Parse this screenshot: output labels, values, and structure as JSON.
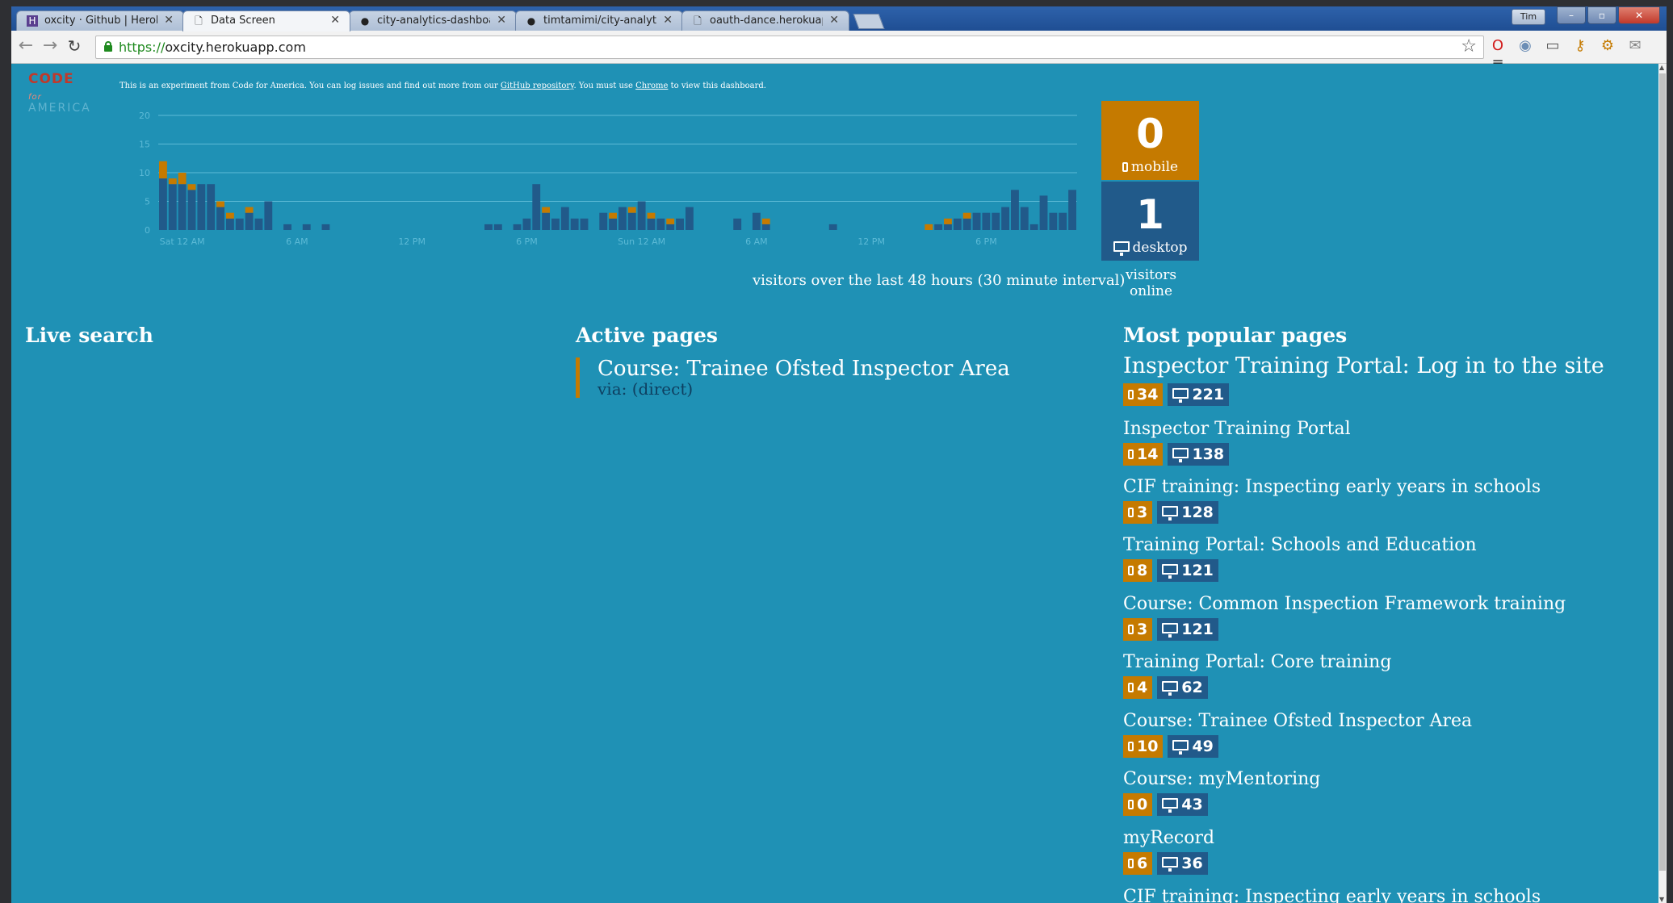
{
  "browser": {
    "tabs": [
      {
        "title": "oxcity · Github | Heroku",
        "icon": "heroku-icon",
        "active": false
      },
      {
        "title": "Data Screen",
        "icon": "page-icon",
        "active": true
      },
      {
        "title": "city-analytics-dashboard/l",
        "icon": "github-icon",
        "active": false
      },
      {
        "title": "timtamimi/city-analytics-d",
        "icon": "github-icon",
        "active": false
      },
      {
        "title": "oauth-dance.herokuapp.c",
        "icon": "page-icon",
        "active": false
      }
    ],
    "user_label": "Tim",
    "url_scheme": "https://",
    "url_host": "oxcity.herokuapp.com"
  },
  "header": {
    "logo_line1": "CODE",
    "logo_line1_small": "for",
    "logo_line2": "AMERICA",
    "intro_before": "This is an experiment from Code for America. You can log issues and find out more from our ",
    "intro_link1": "GitHub repository",
    "intro_middle": ". You must use ",
    "intro_link2": "Chrome",
    "intro_after": " to view this dashboard."
  },
  "chart_data": {
    "type": "bar",
    "stacked": true,
    "title": "",
    "caption": "visitors over the last 48 hours (30 minute interval)",
    "ylim": [
      0,
      20
    ],
    "yticks": [
      0,
      5,
      10,
      15,
      20
    ],
    "xtick_labels": [
      "Sat 12 AM",
      "6 AM",
      "12 PM",
      "6 PM",
      "Sun 12 AM",
      "6 AM",
      "12 PM",
      "6 PM"
    ],
    "xtick_positions": [
      2,
      14,
      26,
      38,
      50,
      62,
      74,
      86
    ],
    "n_bins": 96,
    "grid": true,
    "colors": {
      "desktop": "#215a8a",
      "mobile": "#c57a00"
    },
    "series": [
      {
        "name": "desktop",
        "values": [
          9,
          8,
          8,
          7,
          8,
          8,
          4,
          2,
          2,
          3,
          2,
          5,
          0,
          1,
          0,
          1,
          0,
          1,
          0,
          0,
          0,
          0,
          0,
          0,
          0,
          0,
          0,
          0,
          0,
          0,
          0,
          0,
          0,
          0,
          1,
          1,
          0,
          1,
          2,
          8,
          3,
          2,
          4,
          2,
          2,
          0,
          3,
          2,
          4,
          3,
          5,
          2,
          2,
          1,
          2,
          4,
          0,
          0,
          0,
          0,
          2,
          0,
          3,
          1,
          0,
          0,
          0,
          0,
          0,
          0,
          1,
          0,
          0,
          0,
          0,
          0,
          0,
          0,
          0,
          0,
          0,
          1,
          1,
          2,
          2,
          3,
          3,
          3,
          4,
          7,
          4,
          1,
          6,
          3,
          3,
          7
        ]
      },
      {
        "name": "mobile",
        "values": [
          3,
          1,
          2,
          1,
          0,
          0,
          1,
          1,
          0,
          1,
          0,
          0,
          0,
          0,
          0,
          0,
          0,
          0,
          0,
          0,
          0,
          0,
          0,
          0,
          0,
          0,
          0,
          0,
          0,
          0,
          0,
          0,
          0,
          0,
          0,
          0,
          0,
          0,
          0,
          0,
          1,
          0,
          0,
          0,
          0,
          0,
          0,
          1,
          0,
          1,
          0,
          1,
          0,
          1,
          0,
          0,
          0,
          0,
          0,
          0,
          0,
          0,
          0,
          1,
          0,
          0,
          0,
          0,
          0,
          0,
          0,
          0,
          0,
          0,
          0,
          0,
          0,
          0,
          0,
          0,
          1,
          0,
          1,
          0,
          1,
          0,
          0,
          0,
          0,
          0,
          0,
          0,
          0,
          0,
          0,
          0
        ]
      }
    ]
  },
  "stats": {
    "mobile_count": "0",
    "mobile_label": "mobile",
    "desktop_count": "1",
    "desktop_label": "desktop",
    "online_caption": "visitors online"
  },
  "live_search": {
    "heading": "Live search"
  },
  "active_pages": {
    "heading": "Active pages",
    "items": [
      {
        "title": "Course: Trainee Ofsted Inspector Area",
        "via": "via: (direct)"
      }
    ]
  },
  "popular_pages": {
    "heading": "Most popular pages",
    "items": [
      {
        "title": "Inspector Training Portal: Log in to the site",
        "mobile": "34",
        "desktop": "221"
      },
      {
        "title": "Inspector Training Portal",
        "mobile": "14",
        "desktop": "138"
      },
      {
        "title": "CIF training: Inspecting early years in schools",
        "mobile": "3",
        "desktop": "128"
      },
      {
        "title": "Training Portal: Schools and Education",
        "mobile": "8",
        "desktop": "121"
      },
      {
        "title": "Course: Common Inspection Framework training",
        "mobile": "3",
        "desktop": "121"
      },
      {
        "title": "Training Portal: Core training",
        "mobile": "4",
        "desktop": "62"
      },
      {
        "title": "Course: Trainee Ofsted Inspector Area",
        "mobile": "10",
        "desktop": "49"
      },
      {
        "title": "Course: myMentoring",
        "mobile": "0",
        "desktop": "43"
      },
      {
        "title": "myRecord",
        "mobile": "6",
        "desktop": "36"
      },
      {
        "title": "CIF training: Inspecting early years in schools",
        "mobile": "",
        "desktop": ""
      }
    ]
  }
}
